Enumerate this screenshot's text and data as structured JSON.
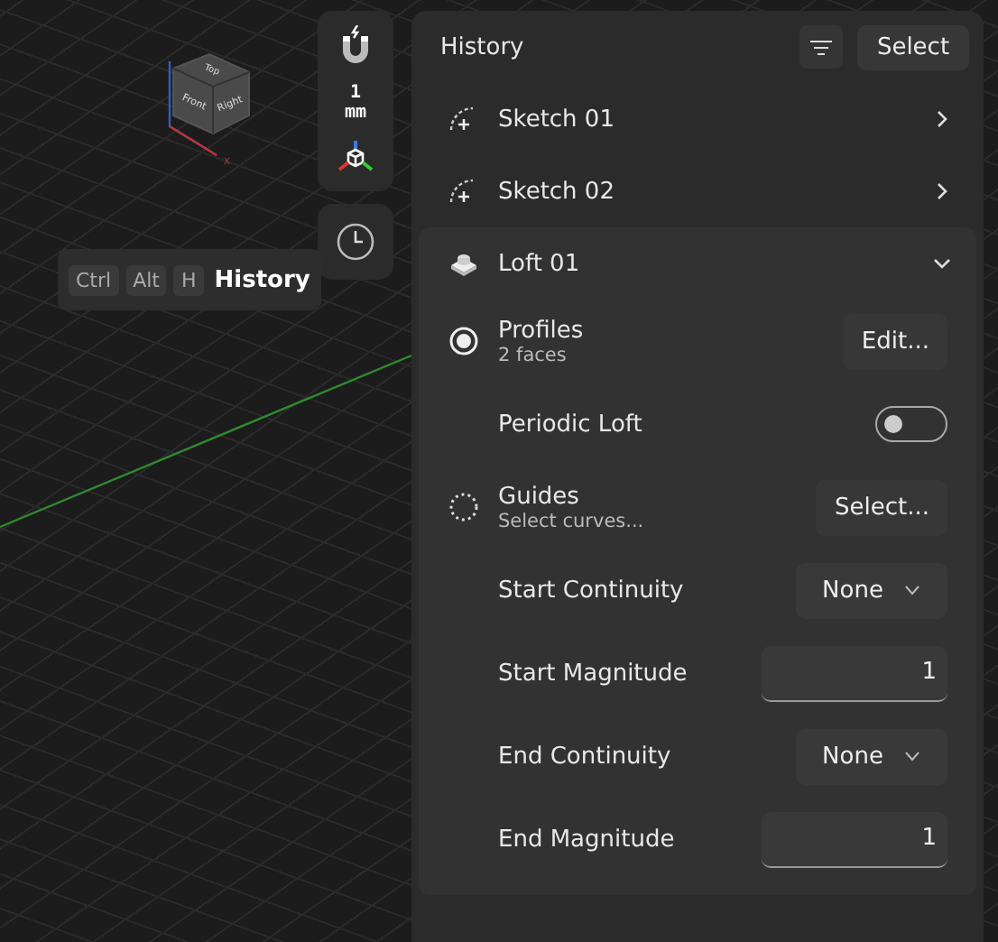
{
  "viewport": {
    "cube_faces": [
      "Top",
      "Front",
      "Right"
    ],
    "axis_label": "X"
  },
  "toolbar": {
    "snap_value": "1",
    "snap_unit": "mm"
  },
  "history_tooltip": {
    "keys": [
      "Ctrl",
      "Alt",
      "H"
    ],
    "label": "History"
  },
  "panel": {
    "title": "History",
    "select_button": "Select",
    "items": [
      {
        "kind": "sketch",
        "name": "Sketch 01",
        "expanded": false
      },
      {
        "kind": "sketch",
        "name": "Sketch 02",
        "expanded": false
      },
      {
        "kind": "loft",
        "name": "Loft 01",
        "expanded": true,
        "properties": [
          {
            "kind": "selection",
            "label": "Profiles",
            "detail": "2 faces",
            "filled": true,
            "button": "Edit..."
          },
          {
            "kind": "toggle",
            "label": "Periodic Loft",
            "on": false
          },
          {
            "kind": "selection",
            "label": "Guides",
            "detail": "Select curves...",
            "filled": false,
            "button": "Select..."
          },
          {
            "kind": "dropdown",
            "label": "Start Continuity",
            "value": "None"
          },
          {
            "kind": "number",
            "label": "Start Magnitude",
            "value": "1"
          },
          {
            "kind": "dropdown",
            "label": "End Continuity",
            "value": "None"
          },
          {
            "kind": "number",
            "label": "End Magnitude",
            "value": "1"
          }
        ]
      }
    ]
  }
}
